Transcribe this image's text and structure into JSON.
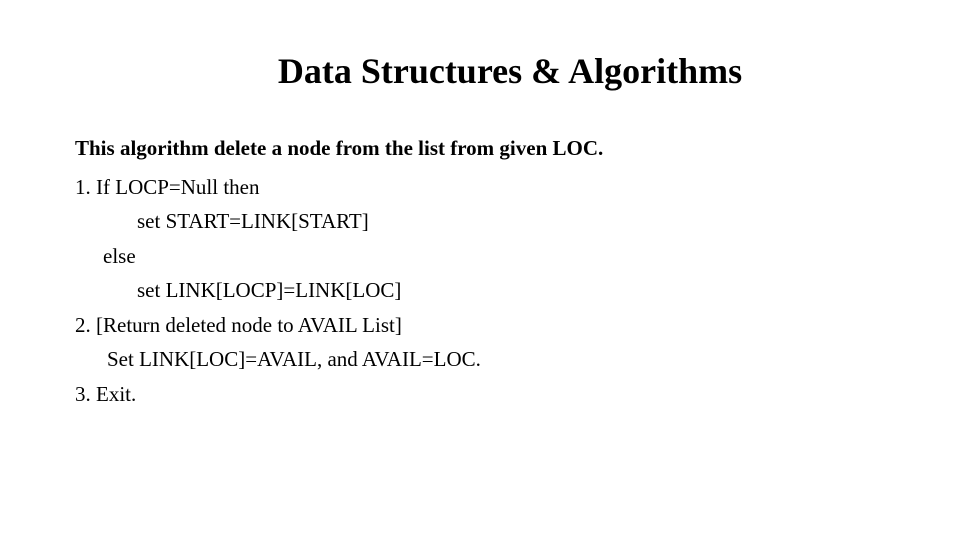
{
  "title": "Data Structures & Algorithms",
  "intro": "This algorithm delete a node from the list from given LOC.",
  "lines": {
    "l1": "1. If  LOCP=Null then",
    "l2": "set START=LINK[START]",
    "l3": "else",
    "l4": "set LINK[LOCP]=LINK[LOC]",
    "l5": "2. [Return deleted node to AVAIL List]",
    "l6": "Set LINK[LOC]=AVAIL, and AVAIL=LOC.",
    "l7": "3. Exit."
  }
}
